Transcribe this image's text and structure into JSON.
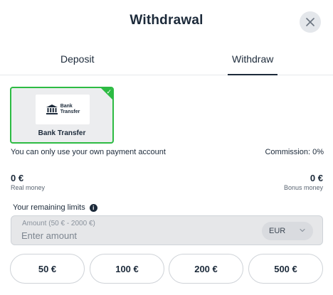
{
  "header": {
    "title": "Withdrawal",
    "close_icon": "close-icon"
  },
  "tabs": [
    {
      "label": "Deposit",
      "active": false
    },
    {
      "label": "Withdraw",
      "active": true
    }
  ],
  "payment_method": {
    "name": "Bank Transfer",
    "logo_line1": "Bank",
    "logo_line2": "Transfer",
    "logo_icon": "bank-icon",
    "selected": true,
    "selected_color": "#2dbb43"
  },
  "info": {
    "own_account_notice": "You can only use your own payment account",
    "commission": "Commission: 0%"
  },
  "balances": {
    "real_amount": "0 €",
    "real_label": "Real money",
    "bonus_amount": "0 €",
    "bonus_label": "Bonus money"
  },
  "limits": {
    "label": "Your remaining limits",
    "icon": "info-icon"
  },
  "amount": {
    "caption": "Amount (50 € - 2000 €)",
    "placeholder": "Enter amount",
    "value": "",
    "currency": "EUR"
  },
  "presets": [
    "50 €",
    "100 €",
    "200 €",
    "500 €"
  ]
}
